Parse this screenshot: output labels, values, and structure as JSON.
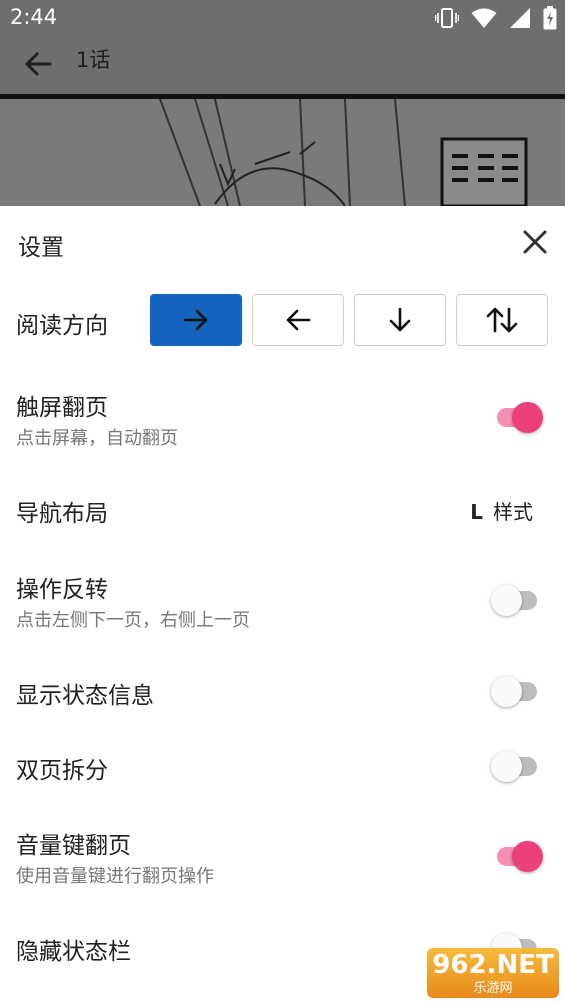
{
  "status": {
    "time": "2:44"
  },
  "appbar": {
    "title": "1话"
  },
  "sheet": {
    "title": "设置",
    "reading_direction_label": "阅读方向",
    "directions": [
      {
        "icon": "arrow-right-icon",
        "active": true
      },
      {
        "icon": "arrow-left-icon",
        "active": false
      },
      {
        "icon": "arrow-down-icon",
        "active": false
      },
      {
        "icon": "arrow-up-down-icon",
        "active": false
      }
    ],
    "rows": {
      "touch_flip": {
        "title": "触屏翻页",
        "subtitle": "点击屏幕，自动翻页",
        "on": true
      },
      "nav_layout": {
        "title": "导航布局",
        "value_letter": "L",
        "value": "样式"
      },
      "reverse_op": {
        "title": "操作反转",
        "subtitle": "点击左侧下一页，右侧上一页",
        "on": false
      },
      "show_status": {
        "title": "显示状态信息",
        "on": false
      },
      "double_split": {
        "title": "双页拆分",
        "on": false
      },
      "volume_flip": {
        "title": "音量键翻页",
        "subtitle": "使用音量键进行翻页操作",
        "on": true
      },
      "hide_statusbar": {
        "title": "隐藏状态栏",
        "on": false
      }
    }
  },
  "watermark": {
    "text": "962.NET",
    "sub": "乐游网"
  },
  "colors": {
    "accent": "#1565c0",
    "switch_on": "#ec407a",
    "overlay": "#6e6e6e"
  }
}
